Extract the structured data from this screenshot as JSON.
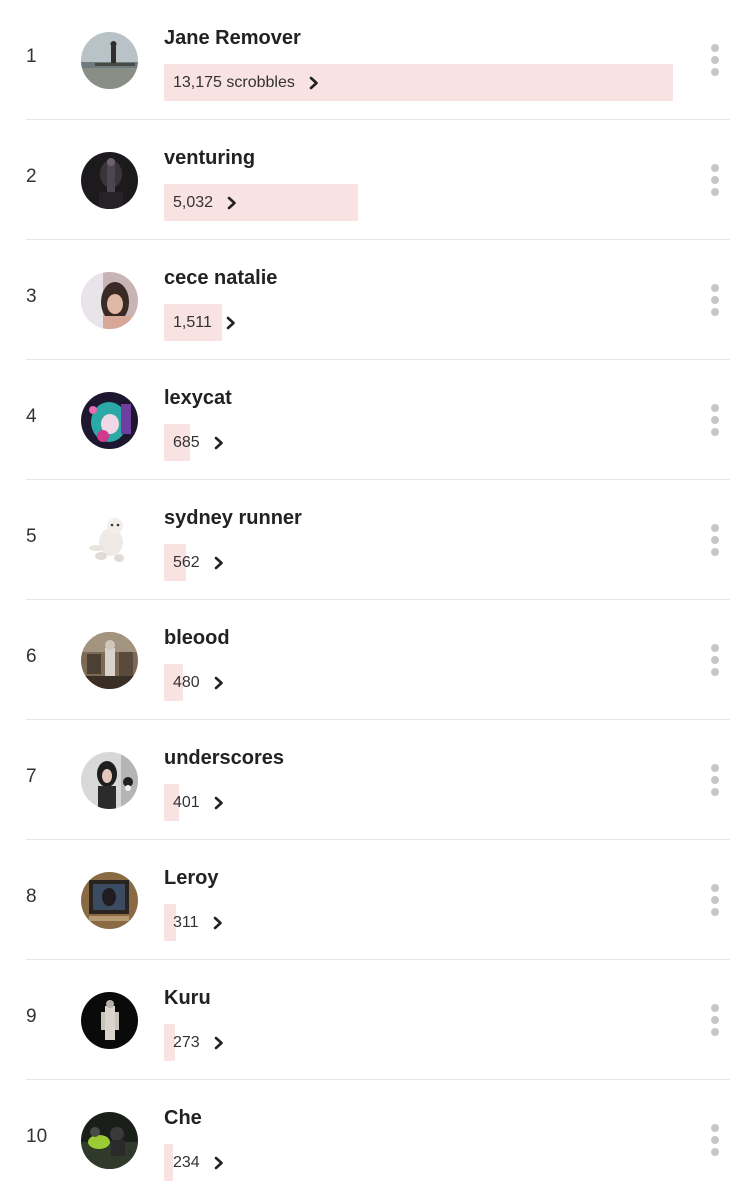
{
  "artists": [
    {
      "rank": "1",
      "name": "Jane Remover",
      "scrobbles": "13,175 scrobbles",
      "count": 13175,
      "avatar": "pier-figure"
    },
    {
      "rank": "2",
      "name": "venturing",
      "scrobbles": "5,032",
      "count": 5032,
      "avatar": "dark-figure"
    },
    {
      "rank": "3",
      "name": "cece natalie",
      "scrobbles": "1,511",
      "count": 1511,
      "avatar": "portrait-girl"
    },
    {
      "rank": "4",
      "name": "lexycat",
      "scrobbles": "685",
      "count": 685,
      "avatar": "anime-character"
    },
    {
      "rank": "5",
      "name": "sydney runner",
      "scrobbles": "562",
      "count": 562,
      "avatar": "white-kitten"
    },
    {
      "rank": "6",
      "name": "bleood",
      "scrobbles": "480",
      "count": 480,
      "avatar": "room-figure"
    },
    {
      "rank": "7",
      "name": "underscores",
      "scrobbles": "401",
      "count": 401,
      "avatar": "mirror-selfie"
    },
    {
      "rank": "8",
      "name": "Leroy",
      "scrobbles": "311",
      "count": 311,
      "avatar": "tv-screen"
    },
    {
      "rank": "9",
      "name": "Kuru",
      "scrobbles": "273",
      "count": 273,
      "avatar": "figure-in-dark"
    },
    {
      "rank": "10",
      "name": "Che",
      "scrobbles": "234",
      "count": 234,
      "avatar": "group-photo"
    }
  ],
  "max_count": 13175,
  "colors": {
    "bar": "#f8e2e2",
    "separator": "#e6e6e6",
    "menu_dots": "#c6c6c6",
    "text": "#222222"
  },
  "icons": {
    "more": "more-vertical-icon",
    "chevron": "chevron-right-icon"
  }
}
